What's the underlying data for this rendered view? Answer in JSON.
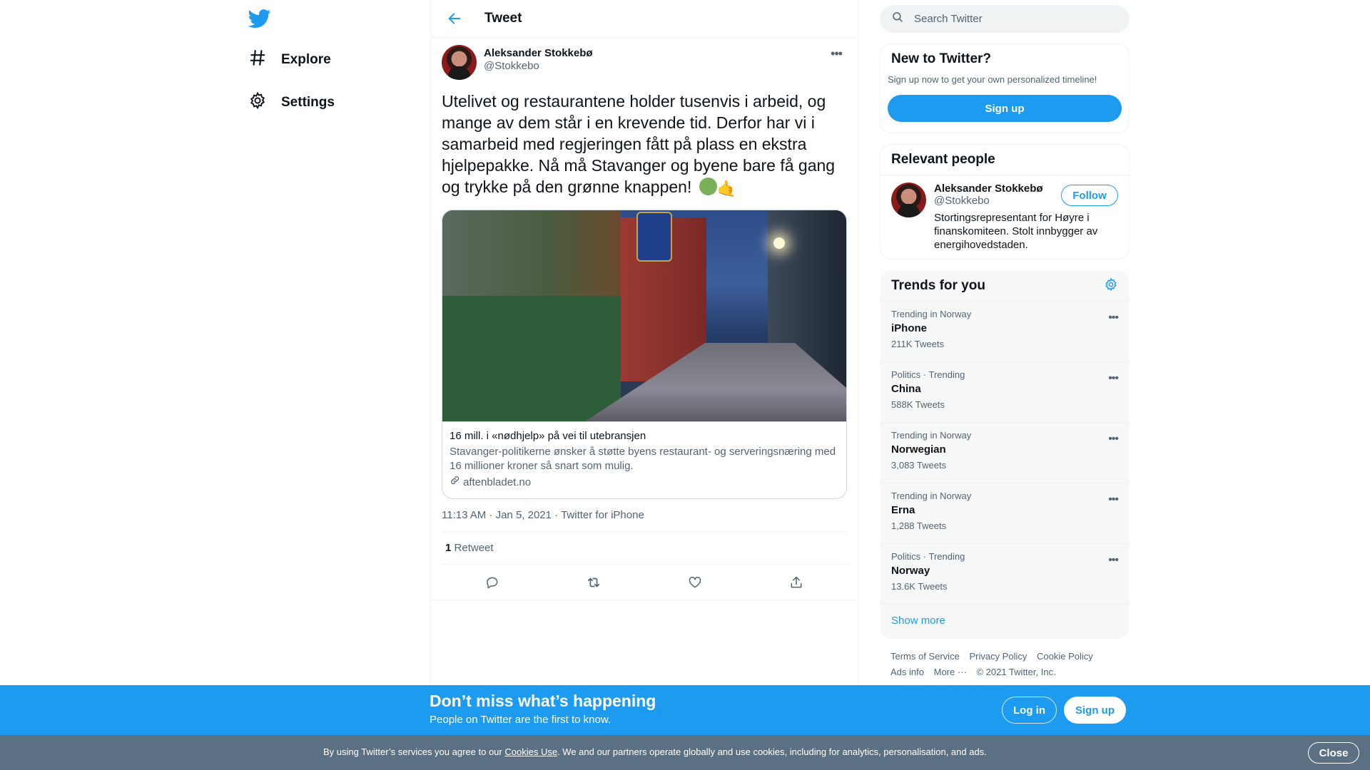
{
  "nav": {
    "items": [
      {
        "label": "Explore",
        "icon": "hash-icon"
      },
      {
        "label": "Settings",
        "icon": "gear-icon"
      }
    ]
  },
  "header": {
    "title": "Tweet"
  },
  "tweet": {
    "author_name": "Aleksander Stokkebø",
    "author_handle": "@Stokkebo",
    "text": "Utelivet og restaurantene holder tusenvis i arbeid, og mange av dem står i en krevende tid. Derfor har vi i samarbeid med regjeringen fått på plass en ekstra hjelpepakke. Nå må Stavanger og byene bare få gang og trykke på den grønne knappen!",
    "card": {
      "title": "16 mill. i «nødhjelp» på vei til utebransjen",
      "description": "Stavanger-politikerne ønsker å støtte byens restaurant- og serveringsnæring med 16 millioner kroner så snart som mulig.",
      "domain": "aftenbladet.no"
    },
    "time": "11:13 AM · Jan 5, 2021",
    "app": "Twitter for iPhone",
    "retweet_count": "1",
    "retweet_label": "Retweet"
  },
  "search": {
    "placeholder": "Search Twitter"
  },
  "new_to_twitter": {
    "title": "New to Twitter?",
    "text": "Sign up now to get your own personalized timeline!",
    "button": "Sign up"
  },
  "relevant_people": {
    "title": "Relevant people",
    "person": {
      "name": "Aleksander Stokkebø",
      "handle": "@Stokkebo",
      "bio": "Stortingsrepresentant for Høyre i finanskomiteen. Stolt innbygger av energihovedstaden.",
      "follow_label": "Follow"
    }
  },
  "trends": {
    "title": "Trends for you",
    "items": [
      {
        "context": "Trending in Norway",
        "name": "iPhone",
        "count": "211K Tweets"
      },
      {
        "context": "Politics · Trending",
        "name": "China",
        "count": "588K Tweets"
      },
      {
        "context": "Trending in Norway",
        "name": "Norwegian",
        "count": "3,083 Tweets"
      },
      {
        "context": "Trending in Norway",
        "name": "Erna",
        "count": "1,288 Tweets"
      },
      {
        "context": "Politics · Trending",
        "name": "Norway",
        "count": "13.6K Tweets"
      }
    ],
    "show_more": "Show more"
  },
  "footer": {
    "links": [
      "Terms of Service",
      "Privacy Policy",
      "Cookie Policy",
      "Ads info",
      "More ···",
      "© 2021 Twitter, Inc."
    ]
  },
  "bottom_bar": {
    "title": "Don’t miss what’s happening",
    "subtitle": "People on Twitter are the first to know.",
    "login": "Log in",
    "signup": "Sign up"
  },
  "cookie": {
    "text_before": "By using Twitter’s services you agree to our ",
    "link": "Cookies Use",
    "text_after": ". We and our partners operate globally and use cookies, including for analytics, personalisation, and ads.",
    "close": "Close"
  },
  "colors": {
    "accent": "#1d9bf0",
    "cookie_bar": "#5b7083"
  }
}
